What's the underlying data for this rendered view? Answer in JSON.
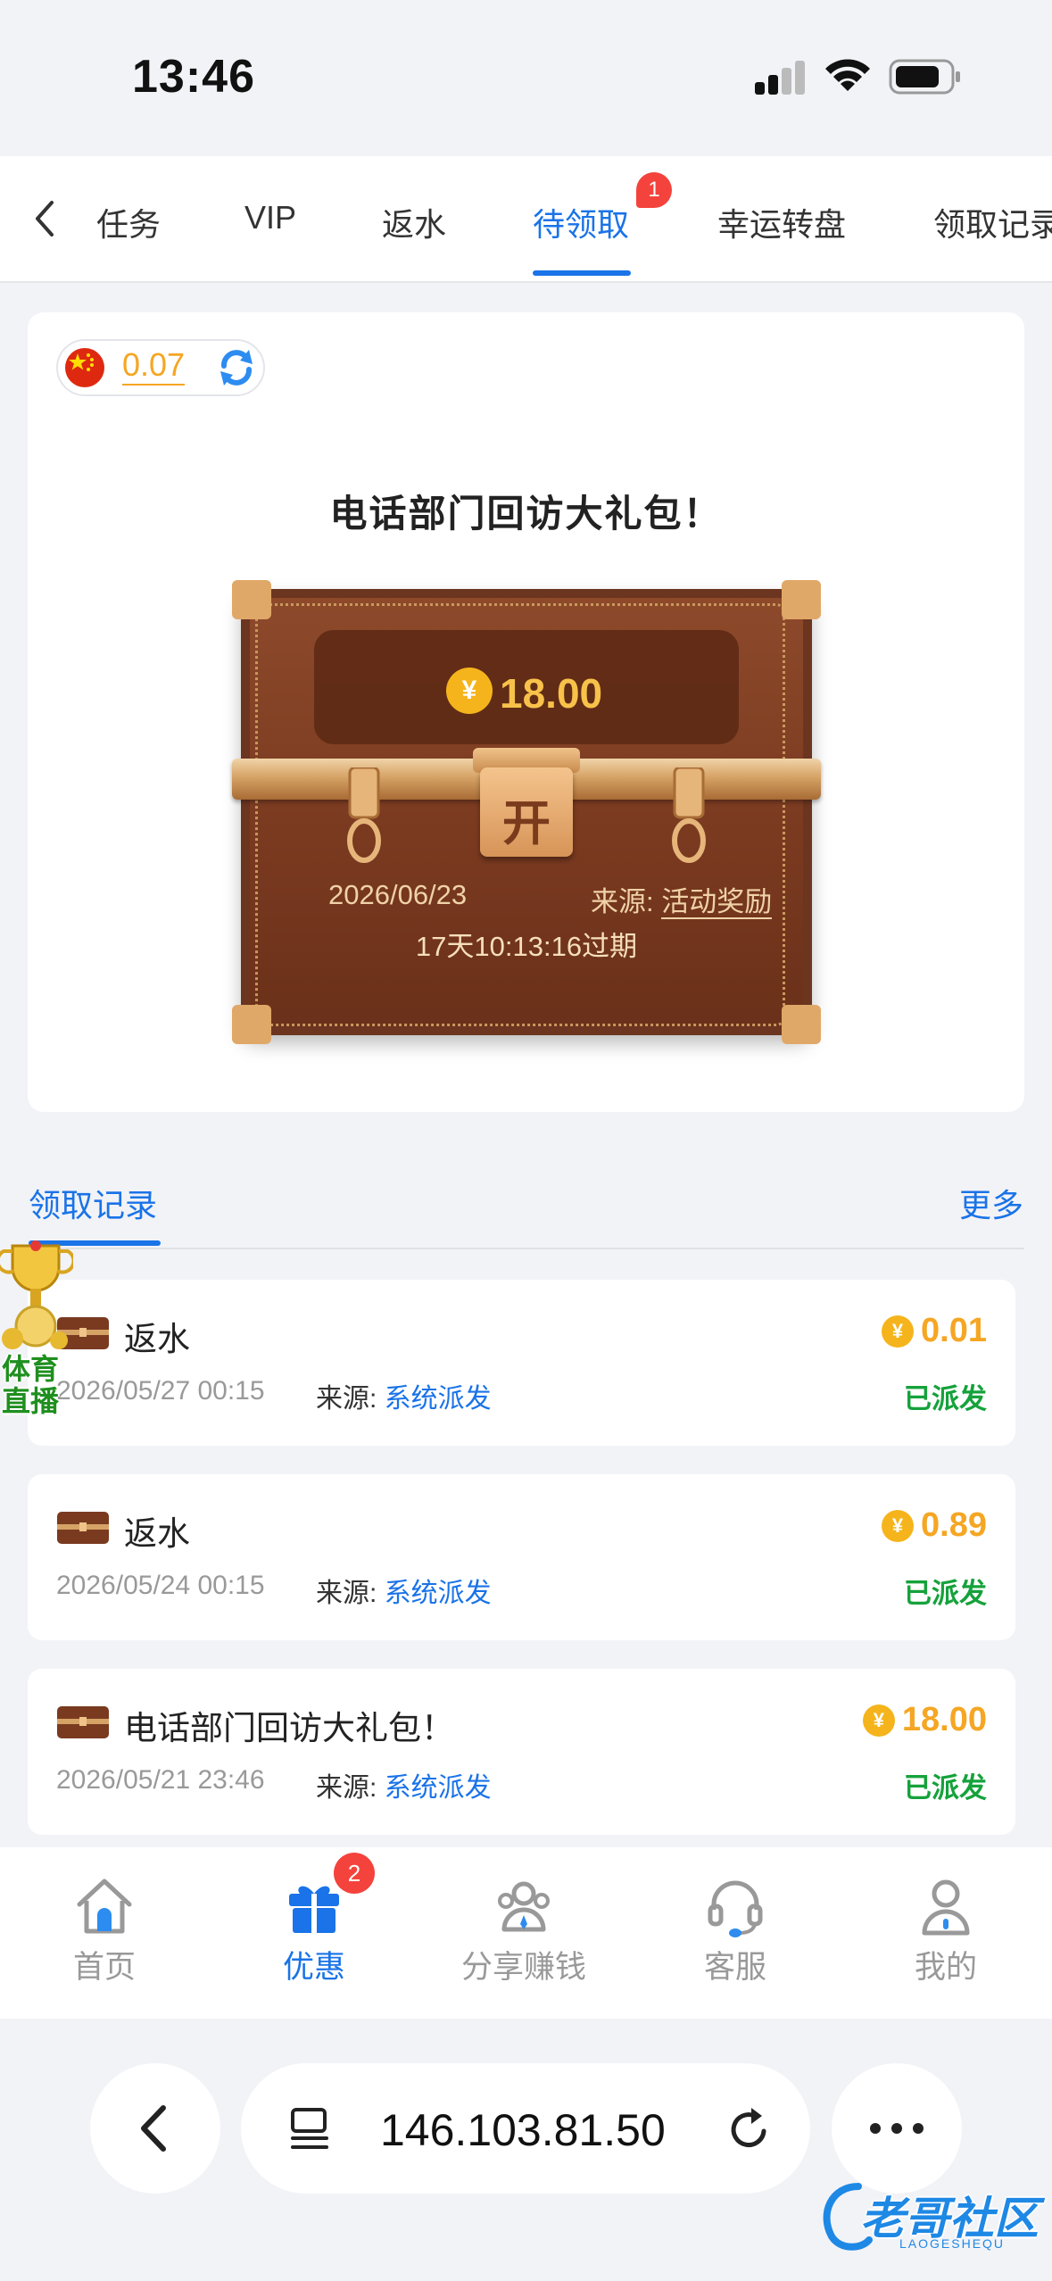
{
  "status_bar": {
    "time": "13:46"
  },
  "tabs": {
    "items": [
      {
        "label": "任务"
      },
      {
        "label": "VIP"
      },
      {
        "label": "返水"
      },
      {
        "label": "待领取",
        "active": true,
        "badge": "1"
      },
      {
        "label": "幸运转盘"
      },
      {
        "label": "领取记录"
      }
    ]
  },
  "balance": {
    "amount": "0.07",
    "flag": "china-flag-icon"
  },
  "gift_card": {
    "title": "电话部门回访大礼包！",
    "amount": "18.00",
    "currency_symbol": "¥",
    "open_label": "开",
    "date": "2026/06/23",
    "source_label": "来源:",
    "source_value": "活动奖励",
    "expiry": "17天10:13:16过期"
  },
  "records": {
    "title": "领取记录",
    "more": "更多",
    "items": [
      {
        "title": "返水",
        "date": "2026/05/27 00:15",
        "source_label": "来源:",
        "source_value": "系统派发",
        "amount": "0.01",
        "status": "已派发"
      },
      {
        "title": "返水",
        "date": "2026/05/24 00:15",
        "source_label": "来源:",
        "source_value": "系统派发",
        "amount": "0.89",
        "status": "已派发"
      },
      {
        "title": "电话部门回访大礼包！",
        "date": "2026/05/21 23:46",
        "source_label": "来源:",
        "source_value": "系统派发",
        "amount": "18.00",
        "status": "已派发"
      }
    ]
  },
  "overlay": {
    "trophy_text_1": "体育",
    "trophy_text_2": "直播"
  },
  "bottom_nav": {
    "items": [
      {
        "label": "首页",
        "icon": "home-icon"
      },
      {
        "label": "优惠",
        "icon": "gift-icon",
        "active": true,
        "badge": "2"
      },
      {
        "label": "分享赚钱",
        "icon": "share-people-icon"
      },
      {
        "label": "客服",
        "icon": "headset-icon"
      },
      {
        "label": "我的",
        "icon": "user-icon"
      }
    ]
  },
  "browser": {
    "url": "146.103.81.50"
  },
  "watermark": {
    "text": "老哥社区",
    "sub": "LAOGESHEQU"
  },
  "colors": {
    "accent": "#1a73e8",
    "coin": "#f5a623",
    "success": "#15a23b",
    "badge": "#f4433c"
  }
}
